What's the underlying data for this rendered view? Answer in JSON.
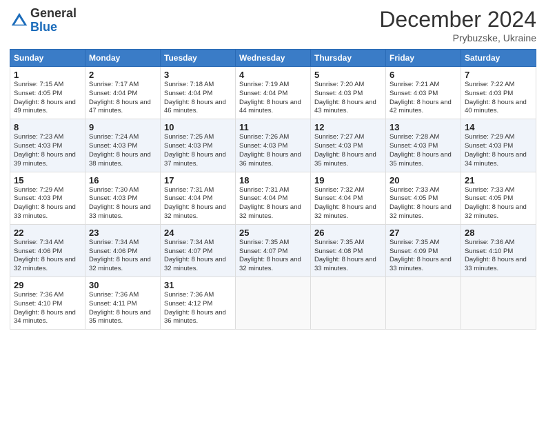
{
  "header": {
    "logo_general": "General",
    "logo_blue": "Blue",
    "month_title": "December 2024",
    "location": "Prybuzske, Ukraine"
  },
  "calendar": {
    "days_of_week": [
      "Sunday",
      "Monday",
      "Tuesday",
      "Wednesday",
      "Thursday",
      "Friday",
      "Saturday"
    ],
    "weeks": [
      [
        null,
        {
          "day": 2,
          "sunrise": "7:17 AM",
          "sunset": "4:04 PM",
          "daylight": "8 hours and 47 minutes."
        },
        {
          "day": 3,
          "sunrise": "7:18 AM",
          "sunset": "4:04 PM",
          "daylight": "8 hours and 46 minutes."
        },
        {
          "day": 4,
          "sunrise": "7:19 AM",
          "sunset": "4:04 PM",
          "daylight": "8 hours and 44 minutes."
        },
        {
          "day": 5,
          "sunrise": "7:20 AM",
          "sunset": "4:03 PM",
          "daylight": "8 hours and 43 minutes."
        },
        {
          "day": 6,
          "sunrise": "7:21 AM",
          "sunset": "4:03 PM",
          "daylight": "8 hours and 42 minutes."
        },
        {
          "day": 7,
          "sunrise": "7:22 AM",
          "sunset": "4:03 PM",
          "daylight": "8 hours and 40 minutes."
        }
      ],
      [
        {
          "day": 1,
          "sunrise": "7:15 AM",
          "sunset": "4:05 PM",
          "daylight": "8 hours and 49 minutes."
        },
        null,
        null,
        null,
        null,
        null,
        null
      ],
      [
        {
          "day": 8,
          "sunrise": "7:23 AM",
          "sunset": "4:03 PM",
          "daylight": "8 hours and 39 minutes."
        },
        {
          "day": 9,
          "sunrise": "7:24 AM",
          "sunset": "4:03 PM",
          "daylight": "8 hours and 38 minutes."
        },
        {
          "day": 10,
          "sunrise": "7:25 AM",
          "sunset": "4:03 PM",
          "daylight": "8 hours and 37 minutes."
        },
        {
          "day": 11,
          "sunrise": "7:26 AM",
          "sunset": "4:03 PM",
          "daylight": "8 hours and 36 minutes."
        },
        {
          "day": 12,
          "sunrise": "7:27 AM",
          "sunset": "4:03 PM",
          "daylight": "8 hours and 35 minutes."
        },
        {
          "day": 13,
          "sunrise": "7:28 AM",
          "sunset": "4:03 PM",
          "daylight": "8 hours and 35 minutes."
        },
        {
          "day": 14,
          "sunrise": "7:29 AM",
          "sunset": "4:03 PM",
          "daylight": "8 hours and 34 minutes."
        }
      ],
      [
        {
          "day": 15,
          "sunrise": "7:29 AM",
          "sunset": "4:03 PM",
          "daylight": "8 hours and 33 minutes."
        },
        {
          "day": 16,
          "sunrise": "7:30 AM",
          "sunset": "4:03 PM",
          "daylight": "8 hours and 33 minutes."
        },
        {
          "day": 17,
          "sunrise": "7:31 AM",
          "sunset": "4:04 PM",
          "daylight": "8 hours and 32 minutes."
        },
        {
          "day": 18,
          "sunrise": "7:31 AM",
          "sunset": "4:04 PM",
          "daylight": "8 hours and 32 minutes."
        },
        {
          "day": 19,
          "sunrise": "7:32 AM",
          "sunset": "4:04 PM",
          "daylight": "8 hours and 32 minutes."
        },
        {
          "day": 20,
          "sunrise": "7:33 AM",
          "sunset": "4:05 PM",
          "daylight": "8 hours and 32 minutes."
        },
        {
          "day": 21,
          "sunrise": "7:33 AM",
          "sunset": "4:05 PM",
          "daylight": "8 hours and 32 minutes."
        }
      ],
      [
        {
          "day": 22,
          "sunrise": "7:34 AM",
          "sunset": "4:06 PM",
          "daylight": "8 hours and 32 minutes."
        },
        {
          "day": 23,
          "sunrise": "7:34 AM",
          "sunset": "4:06 PM",
          "daylight": "8 hours and 32 minutes."
        },
        {
          "day": 24,
          "sunrise": "7:34 AM",
          "sunset": "4:07 PM",
          "daylight": "8 hours and 32 minutes."
        },
        {
          "day": 25,
          "sunrise": "7:35 AM",
          "sunset": "4:07 PM",
          "daylight": "8 hours and 32 minutes."
        },
        {
          "day": 26,
          "sunrise": "7:35 AM",
          "sunset": "4:08 PM",
          "daylight": "8 hours and 33 minutes."
        },
        {
          "day": 27,
          "sunrise": "7:35 AM",
          "sunset": "4:09 PM",
          "daylight": "8 hours and 33 minutes."
        },
        {
          "day": 28,
          "sunrise": "7:36 AM",
          "sunset": "4:10 PM",
          "daylight": "8 hours and 33 minutes."
        }
      ],
      [
        {
          "day": 29,
          "sunrise": "7:36 AM",
          "sunset": "4:10 PM",
          "daylight": "8 hours and 34 minutes."
        },
        {
          "day": 30,
          "sunrise": "7:36 AM",
          "sunset": "4:11 PM",
          "daylight": "8 hours and 35 minutes."
        },
        {
          "day": 31,
          "sunrise": "7:36 AM",
          "sunset": "4:12 PM",
          "daylight": "8 hours and 36 minutes."
        },
        null,
        null,
        null,
        null
      ]
    ]
  }
}
